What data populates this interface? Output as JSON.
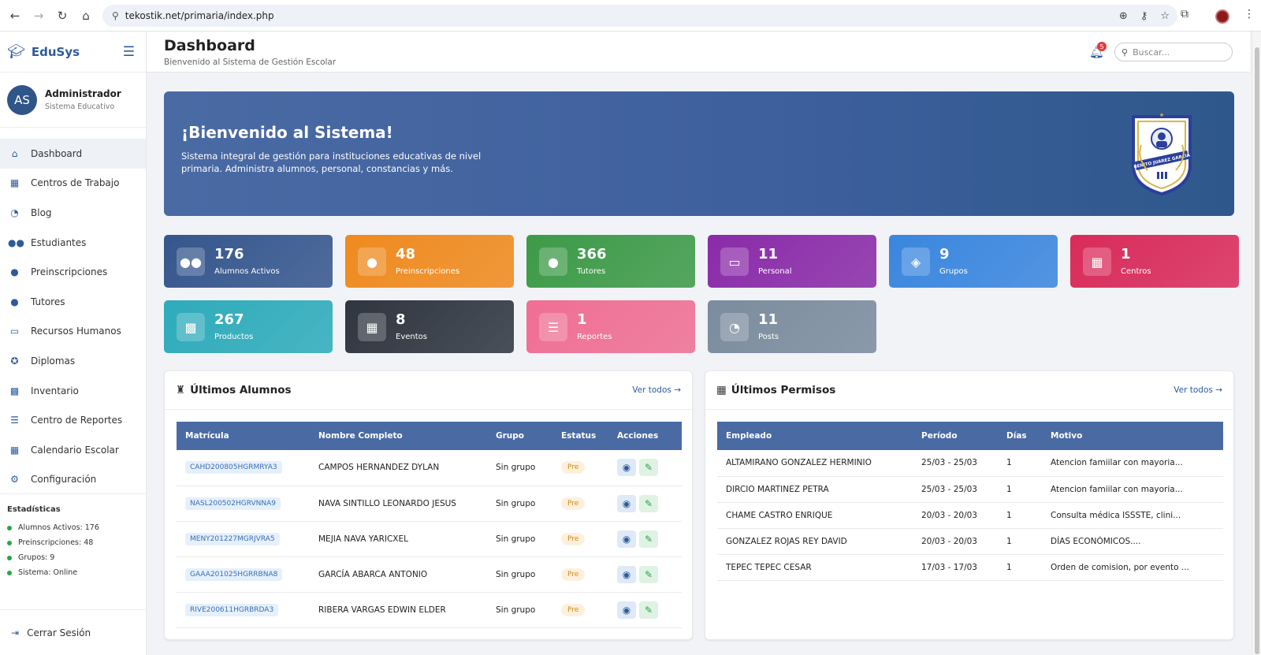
{
  "browser": {
    "url": "tekostik.net/primaria/index.php"
  },
  "brand": {
    "name": "EduSys"
  },
  "user": {
    "initials": "AS",
    "name": "Administrador",
    "role": "Sistema Educativo"
  },
  "menu": [
    {
      "label": "Dashboard",
      "icon": "home-icon",
      "glyph": "⌂"
    },
    {
      "label": "Centros de Trabajo",
      "icon": "building-icon",
      "glyph": "▦"
    },
    {
      "label": "Blog",
      "icon": "blog-icon",
      "glyph": "◔"
    },
    {
      "label": "Estudiantes",
      "icon": "students-icon",
      "glyph": "●●"
    },
    {
      "label": "Preinscripciones",
      "icon": "user-clock-icon",
      "glyph": "●"
    },
    {
      "label": "Tutores",
      "icon": "user-icon",
      "glyph": "●"
    },
    {
      "label": "Recursos Humanos",
      "icon": "chalkboard-user-icon",
      "glyph": "▭"
    },
    {
      "label": "Diplomas",
      "icon": "award-icon",
      "glyph": "✪"
    },
    {
      "label": "Inventario",
      "icon": "boxes-icon",
      "glyph": "▩"
    },
    {
      "label": "Centro de Reportes",
      "icon": "chart-list-icon",
      "glyph": "☰"
    },
    {
      "label": "Calendario Escolar",
      "icon": "calendar-icon",
      "glyph": "▦"
    },
    {
      "label": "Configuración",
      "icon": "gear-icon",
      "glyph": "⚙"
    }
  ],
  "stats": {
    "title": "Estadísticas",
    "items": [
      "Alumnos Activos: 176",
      "Preinscripciones: 48",
      "Grupos: 9",
      "Sistema: Online"
    ]
  },
  "logout": {
    "label": "Cerrar Sesión"
  },
  "header": {
    "title": "Dashboard",
    "subtitle": "Bienvenido al Sistema de Gestión Escolar",
    "notifications": "5",
    "search_placeholder": "Buscar..."
  },
  "hero": {
    "title": "¡Bienvenido al Sistema!",
    "text": "Sistema integral de gestión para instituciones educativas de nivel primaria. Administra alumnos, personal, constancias y más.",
    "crest_text": "BENITO JUAREZ GARCIA"
  },
  "cards": [
    {
      "value": "176",
      "label": "Alumnos Activos",
      "color": "#35568d",
      "icon": "users-icon",
      "glyph": "●●"
    },
    {
      "value": "48",
      "label": "Preinscripciones",
      "color": "#ef8a1e",
      "icon": "user-clock-icon",
      "glyph": "●"
    },
    {
      "value": "366",
      "label": "Tutores",
      "color": "#3d9a48",
      "icon": "user-tie-icon",
      "glyph": "●"
    },
    {
      "value": "11",
      "label": "Personal",
      "color": "#8a2ba8",
      "icon": "chalkboard-icon",
      "glyph": "▭"
    },
    {
      "value": "9",
      "label": "Grupos",
      "color": "#3a86de",
      "icon": "layers-icon",
      "glyph": "◈"
    },
    {
      "value": "1",
      "label": "Centros",
      "color": "#d92b5a",
      "icon": "school-icon",
      "glyph": "▦"
    },
    {
      "value": "267",
      "label": "Productos",
      "color": "#2eabbb",
      "icon": "boxes-icon",
      "glyph": "▩"
    },
    {
      "value": "8",
      "label": "Eventos",
      "color": "#2f3640",
      "icon": "calendar-icon",
      "glyph": "▦"
    },
    {
      "value": "1",
      "label": "Reportes",
      "color": "#ef6f93",
      "icon": "chart-icon",
      "glyph": "☰"
    },
    {
      "value": "11",
      "label": "Posts",
      "color": "#7b8c9e",
      "icon": "blog-icon",
      "glyph": "◔"
    }
  ],
  "alumnos": {
    "title": "Últimos Alumnos",
    "view_all": "Ver todos →",
    "columns": [
      "Matrícula",
      "Nombre Completo",
      "Grupo",
      "Estatus",
      "Acciones"
    ],
    "rows": [
      {
        "matricula": "CAHD200805HGRMRYA3",
        "nombre": "CAMPOS HERNANDEZ DYLAN",
        "grupo": "Sin grupo",
        "estatus": "Pre"
      },
      {
        "matricula": "NASL200502HGRVNNA9",
        "nombre": "NAVA SINTILLO LEONARDO JESUS",
        "grupo": "Sin grupo",
        "estatus": "Pre"
      },
      {
        "matricula": "MENY201227MGRJVRA5",
        "nombre": "MEJIA NAVA YARICXEL",
        "grupo": "Sin grupo",
        "estatus": "Pre"
      },
      {
        "matricula": "GAAA201025HGRRBNA8",
        "nombre": "GARCÍA ABARCA ANTONIO",
        "grupo": "Sin grupo",
        "estatus": "Pre"
      },
      {
        "matricula": "RIVE200611HGRBRDA3",
        "nombre": "RIBERA VARGAS EDWIN ELDER",
        "grupo": "Sin grupo",
        "estatus": "Pre"
      }
    ]
  },
  "permisos": {
    "title": "Últimos Permisos",
    "view_all": "Ver todos →",
    "columns": [
      "Empleado",
      "Período",
      "Días",
      "Motivo"
    ],
    "rows": [
      {
        "empleado": "ALTAMIRANO GONZALEZ HERMINIO",
        "periodo": "25/03 - 25/03",
        "dias": "1",
        "motivo": "Atencion famiilar con mayoria..."
      },
      {
        "empleado": "DIRCIO MARTINEZ PETRA",
        "periodo": "25/03 - 25/03",
        "dias": "1",
        "motivo": "Atencion famiilar con mayoria..."
      },
      {
        "empleado": "CHAME CASTRO ENRIQUE",
        "periodo": "20/03 - 20/03",
        "dias": "1",
        "motivo": "Consulta médica ISSSTE, clini..."
      },
      {
        "empleado": "GONZALEZ ROJAS REY DAVID",
        "periodo": "20/03 - 20/03",
        "dias": "1",
        "motivo": "DÍAS ECONÓMICOS...."
      },
      {
        "empleado": "TEPEC TEPEC CESAR",
        "periodo": "17/03 - 17/03",
        "dias": "1",
        "motivo": "Orden de comision, por evento ..."
      }
    ]
  }
}
